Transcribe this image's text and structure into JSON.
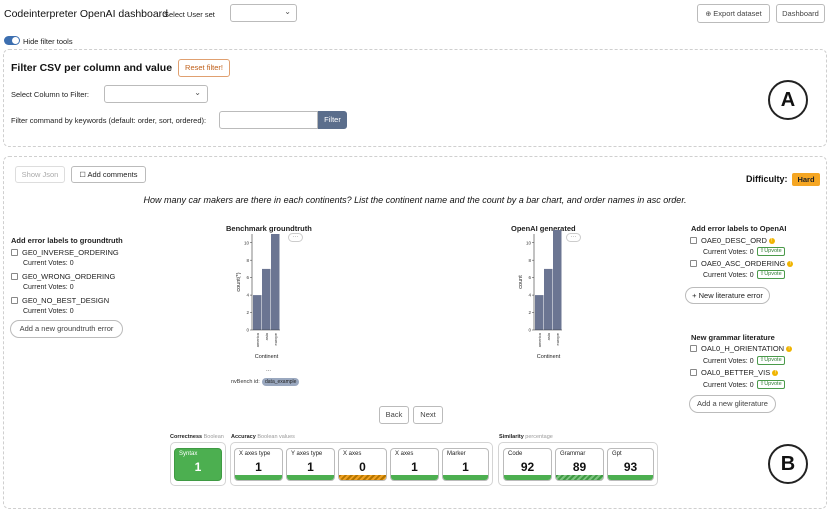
{
  "header": {
    "title": "Codeinterpreter OpenAI dashboard",
    "user_set_label": "Select User set",
    "user_set_value": "",
    "export_label": "Export dataset",
    "dashboard_label": "Dashboard"
  },
  "toggle": {
    "label": "Hide filter tools",
    "on": true
  },
  "filter": {
    "title": "Filter CSV per column and value",
    "reset_label": "Reset filter!",
    "column_label": "Select Column to Filter:",
    "column_value": "",
    "keyword_label": "Filter command by keywords (default: order, sort, ordered):",
    "keyword_value": "",
    "filter_button": "Filter",
    "marker": "A"
  },
  "main": {
    "show_json_label": "Show Json",
    "add_comments_label": "Add comments",
    "difficulty_label": "Difficulty:",
    "difficulty_value": "Hard",
    "question": "How many car makers are there in each continents? List the continent name and the count by a bar chart, and order names in asc order.",
    "marker": "B"
  },
  "groundtruth_errors": {
    "title": "Add error labels to groundtruth",
    "items": [
      {
        "label": "GE0_INVERSE_ORDERING",
        "votes": "Current Votes: 0"
      },
      {
        "label": "GE0_WRONG_ORDERING",
        "votes": "Current Votes: 0"
      },
      {
        "label": "GE0_NO_BEST_DESIGN",
        "votes": "Current Votes: 0"
      }
    ],
    "add_button": "Add a new groundtruth error"
  },
  "openai_errors": {
    "title": "Add error labels to OpenAI",
    "items": [
      {
        "label": "OAE0_DESC_ORD",
        "votes": "Current Votes: 0",
        "upvote": "Upvote"
      },
      {
        "label": "OAE0_ASC_ORDERING",
        "votes": "Current Votes: 0",
        "upvote": "Upvote"
      }
    ],
    "add_button": "+ New literature error"
  },
  "grammar": {
    "title": "New grammar literature",
    "items": [
      {
        "label": "OAL0_H_ORIENTATION",
        "votes": "Current Votes: 0",
        "upvote": "Upvote"
      },
      {
        "label": "OAL0_BETTER_VIS",
        "votes": "Current Votes: 0",
        "upvote": "Upvote"
      }
    ],
    "add_button": "Add a new gliterature"
  },
  "benchmark_chart": {
    "caption": "nvBench id:",
    "caption_tag": "data_example"
  },
  "nav": {
    "back_label": "Back",
    "next_label": "Next"
  },
  "metrics": {
    "correctness": {
      "title": "Correctness",
      "subtitle": "Boolean"
    },
    "accuracy": {
      "title": "Accuracy",
      "subtitle": "Boolean values"
    },
    "similarity": {
      "title": "Similarity",
      "subtitle": "percentage"
    },
    "cards": [
      {
        "label": "Syntax",
        "value": "1",
        "status": "full"
      },
      {
        "label": "X axes type",
        "value": "1",
        "status": "pass"
      },
      {
        "label": "Y axes type",
        "value": "1",
        "status": "pass"
      },
      {
        "label": "X axes",
        "value": "0",
        "status": "fail"
      },
      {
        "label": "X axes",
        "value": "1",
        "status": "pass"
      },
      {
        "label": "Marker",
        "value": "1",
        "status": "pass"
      },
      {
        "label": "Code",
        "value": "92",
        "status": "pass"
      },
      {
        "label": "Grammar",
        "value": "89",
        "status": "partial"
      },
      {
        "label": "Gpt",
        "value": "93",
        "status": "pass"
      }
    ]
  },
  "chart_data": [
    {
      "type": "bar",
      "title": "Benchmark groundtruth",
      "xlabel": "Continent",
      "ylabel": "count(*)",
      "categories": [
        "america",
        "asia",
        "europe"
      ],
      "values": [
        4,
        7,
        11
      ],
      "ylim": [
        0,
        11
      ],
      "yticks": [
        0,
        2,
        4,
        6,
        8,
        10
      ],
      "color": "#6b7592"
    },
    {
      "type": "bar",
      "title": "OpenAI generated",
      "xlabel": "Continent",
      "ylabel": "count",
      "categories": [
        "america",
        "asia",
        "europe"
      ],
      "values": [
        4,
        7,
        13
      ],
      "ylim": [
        0,
        11
      ],
      "yticks": [
        0,
        2,
        4,
        6,
        8,
        10
      ],
      "color": "#6b7592"
    }
  ]
}
